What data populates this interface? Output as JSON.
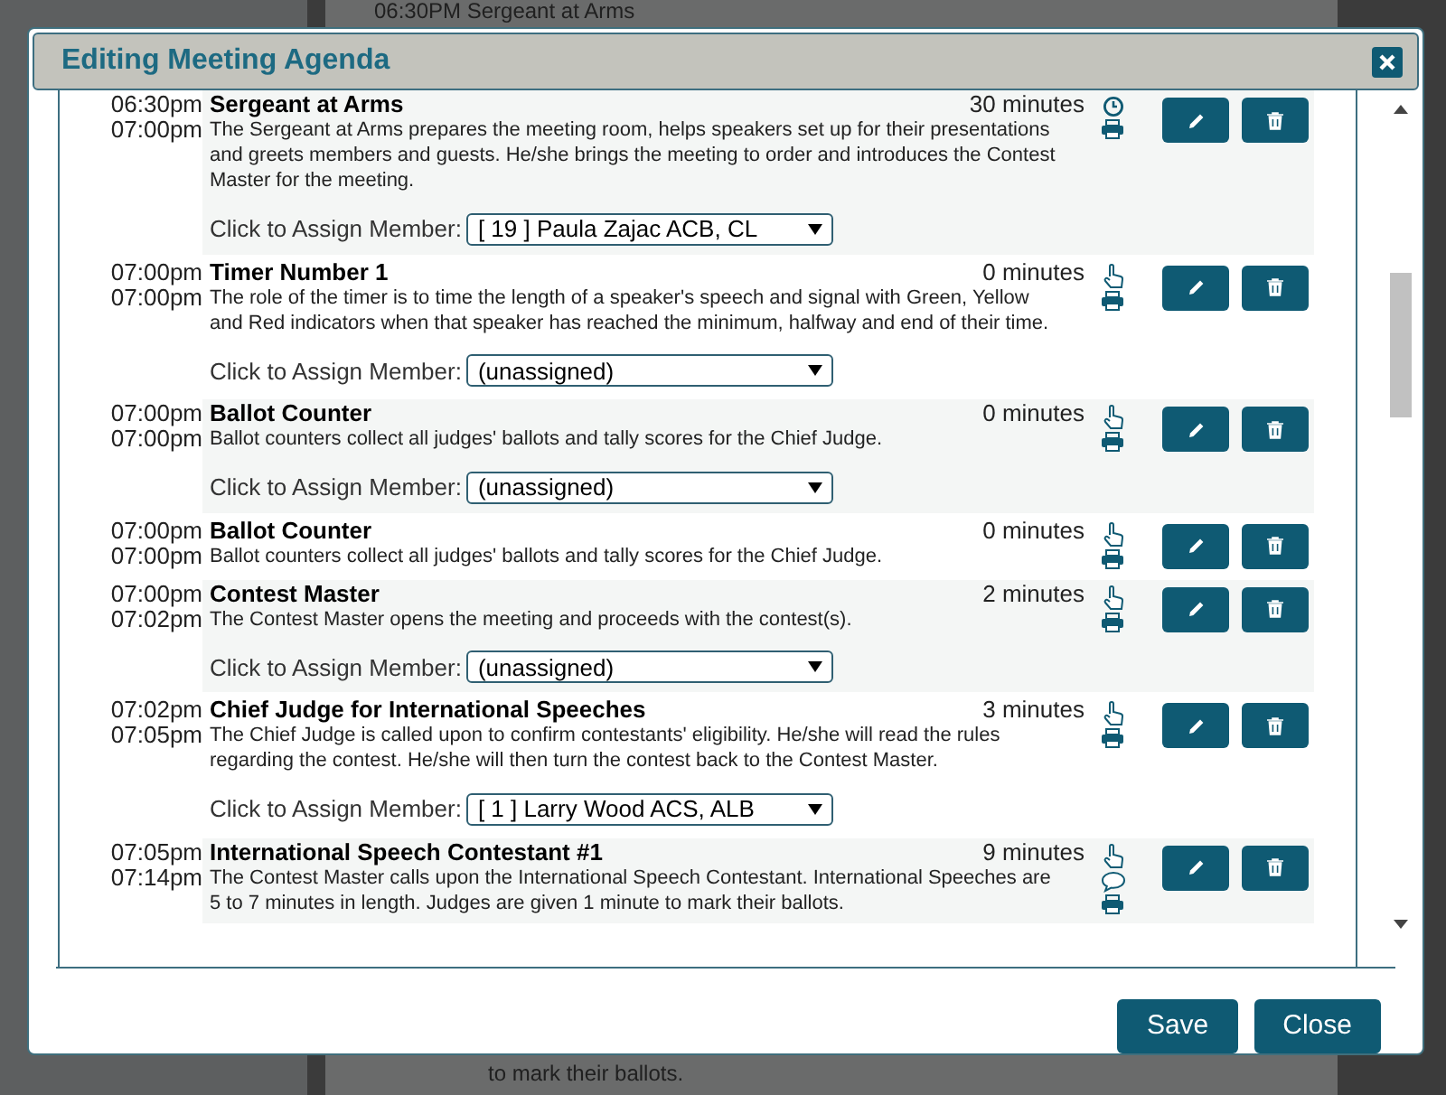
{
  "background": {
    "top_text": "06:30PM Sergeant at Arms",
    "bottom_text": "to mark their ballots."
  },
  "dialog": {
    "title": "Editing Meeting Agenda",
    "agenda_items": [
      {
        "start": "06:30pm",
        "end": "07:00pm",
        "title": "Sergeant at Arms",
        "duration": "30 minutes",
        "description": "The Sergeant at Arms prepares the meeting room, helps speakers set up for their presentations and greets members and guests. He/she brings the meeting to order and introduces the Contest Master for the meeting.",
        "assign": {
          "label": "Click to Assign Member:",
          "value": "[ 19 ] Paula Zajac ACB, CL"
        },
        "kind": "locked"
      },
      {
        "start": "07:00pm",
        "end": "07:00pm",
        "title": "Timer Number 1",
        "duration": "0 minutes",
        "description": "The role of the timer is to time the length of a speaker's speech and signal with Green, Yellow and Red indicators when that speaker has reached the minimum, halfway and end of their time.",
        "assign": {
          "label": "Click to Assign Member:",
          "value": "(unassigned)"
        },
        "kind": "open"
      },
      {
        "start": "07:00pm",
        "end": "07:00pm",
        "title": "Ballot Counter",
        "duration": "0 minutes",
        "description": "Ballot counters collect all judges' ballots and tally scores for the Chief Judge.",
        "assign": {
          "label": "Click to Assign Member:",
          "value": "(unassigned)"
        },
        "kind": "open"
      },
      {
        "start": "07:00pm",
        "end": "07:00pm",
        "title": "Ballot Counter",
        "duration": "0 minutes",
        "description": "Ballot counters collect all judges' ballots and tally scores for the Chief Judge.",
        "kind": "open"
      },
      {
        "start": "07:00pm",
        "end": "07:02pm",
        "title": "Contest Master",
        "duration": "2 minutes",
        "description": "The Contest Master opens the meeting and proceeds with the contest(s).",
        "assign": {
          "label": "Click to Assign Member:",
          "value": "(unassigned)"
        },
        "kind": "open"
      },
      {
        "start": "07:02pm",
        "end": "07:05pm",
        "title": "Chief Judge for International Speeches",
        "duration": "3 minutes",
        "description": "The Chief Judge is called upon to confirm contestants' eligibility. He/she will read the rules regarding the contest. He/she will then turn the contest back to the Contest Master.",
        "assign": {
          "label": "Click to Assign Member:",
          "value": "[ 1 ] Larry Wood ACS, ALB"
        },
        "kind": "open"
      },
      {
        "start": "07:05pm",
        "end": "07:14pm",
        "title": "International Speech Contestant #1",
        "duration": "9 minutes",
        "description": "The Contest Master calls upon the International Speech Contestant. International Speeches are 5 to 7 minutes in length. Judges are given 1 minute to mark their ballots.",
        "kind": "speech"
      }
    ],
    "buttons": [
      {
        "label": "Save"
      },
      {
        "label": "Close"
      }
    ]
  }
}
